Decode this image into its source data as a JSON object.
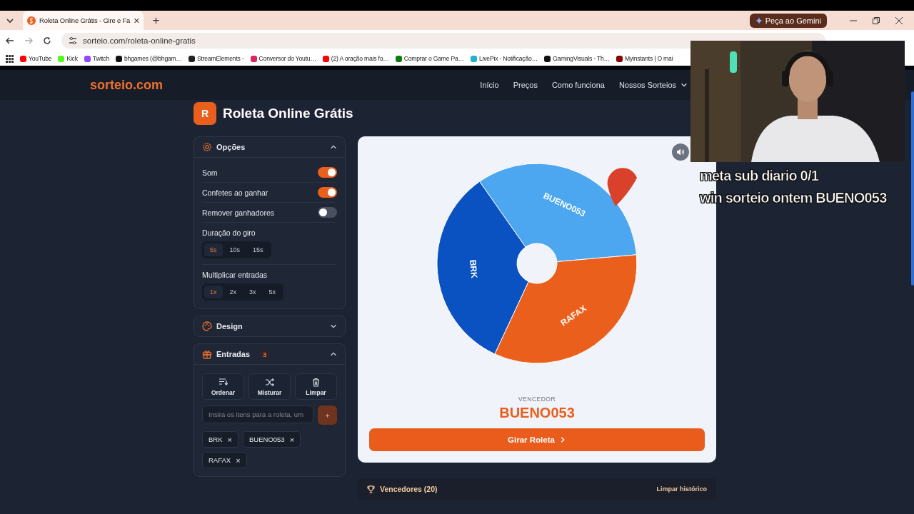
{
  "browser": {
    "tab": {
      "title": "Roleta Online Grátis - Gire e Fa",
      "close": "×"
    },
    "new_tab": "+",
    "gemini": "Peça ao Gemini",
    "url": "sorteio.com/roleta-online-gratis",
    "bookmarks": [
      {
        "label": "YouTube",
        "color": "#ff0000"
      },
      {
        "label": "Kick",
        "color": "#53fc18"
      },
      {
        "label": "Twitch",
        "color": "#9146ff"
      },
      {
        "label": "bhgames (@bhgam…",
        "color": "#111111"
      },
      {
        "label": "StreamElements -",
        "color": "#222222"
      },
      {
        "label": "Conversor do Youtu…",
        "color": "#e0245e"
      },
      {
        "label": "(2) A oração mais fo…",
        "color": "#ff0000"
      },
      {
        "label": "Comprar o Game Pa…",
        "color": "#107c10"
      },
      {
        "label": "LivePix - Notificação…",
        "color": "#20b2c8"
      },
      {
        "label": "GamingVisuals - Th…",
        "color": "#111111"
      },
      {
        "label": "Myinstants | O mai",
        "color": "#8b0000"
      }
    ]
  },
  "site": {
    "logo": "sorteio.com",
    "nav": [
      "Início",
      "Preços",
      "Como funciona",
      "Nossos Sorteios"
    ]
  },
  "page": {
    "badge": "R",
    "title": "Roleta Online Grátis"
  },
  "options": {
    "title": "Opções",
    "expanded": true,
    "toggles": [
      {
        "label": "Som",
        "on": true
      },
      {
        "label": "Confetes ao ganhar",
        "on": true
      },
      {
        "label": "Remover ganhadores",
        "on": false
      }
    ],
    "duration": {
      "label": "Duração do giro",
      "choices": [
        {
          "label": "5s",
          "selected": true
        },
        {
          "label": "10s",
          "selected": false
        },
        {
          "label": "15s",
          "selected": false
        }
      ]
    },
    "multiply": {
      "label": "Multiplicar entradas",
      "choices": [
        {
          "label": "1x",
          "selected": true
        },
        {
          "label": "2x",
          "selected": false
        },
        {
          "label": "3x",
          "selected": false
        },
        {
          "label": "5x",
          "selected": false
        }
      ]
    }
  },
  "design": {
    "title": "Design",
    "expanded": false
  },
  "entries": {
    "title": "Entradas",
    "count": "3",
    "expanded": true,
    "actions": [
      {
        "kind": "sort",
        "label": "Ordenar"
      },
      {
        "kind": "shuffle",
        "label": "Misturar"
      },
      {
        "kind": "trash",
        "label": "Limpar"
      }
    ],
    "placeholder": "Insira os itens para a roleta, um",
    "add": "+",
    "chips": [
      {
        "label": "BRK",
        "remove": "×"
      },
      {
        "label": "BUENO053",
        "remove": "×"
      },
      {
        "label": "RAFAX",
        "remove": "×"
      }
    ]
  },
  "wheel": {
    "segments": [
      {
        "label": "BUENO053",
        "color": "#4da6f0"
      },
      {
        "label": "RAFAX",
        "color": "#ea5f1c"
      },
      {
        "label": "BRK",
        "color": "#0a52c2"
      }
    ],
    "winner_label": "VENCEDOR",
    "winner": "BUENO053",
    "spin": "Girar Roleta"
  },
  "winners": {
    "title": "Vencedores (20)",
    "clear": "Limpar histórico"
  },
  "overlay": {
    "kind": "picture",
    "lines": [
      "meta sub diario 0/1",
      "win sorteio ontem BUENO053"
    ]
  }
}
